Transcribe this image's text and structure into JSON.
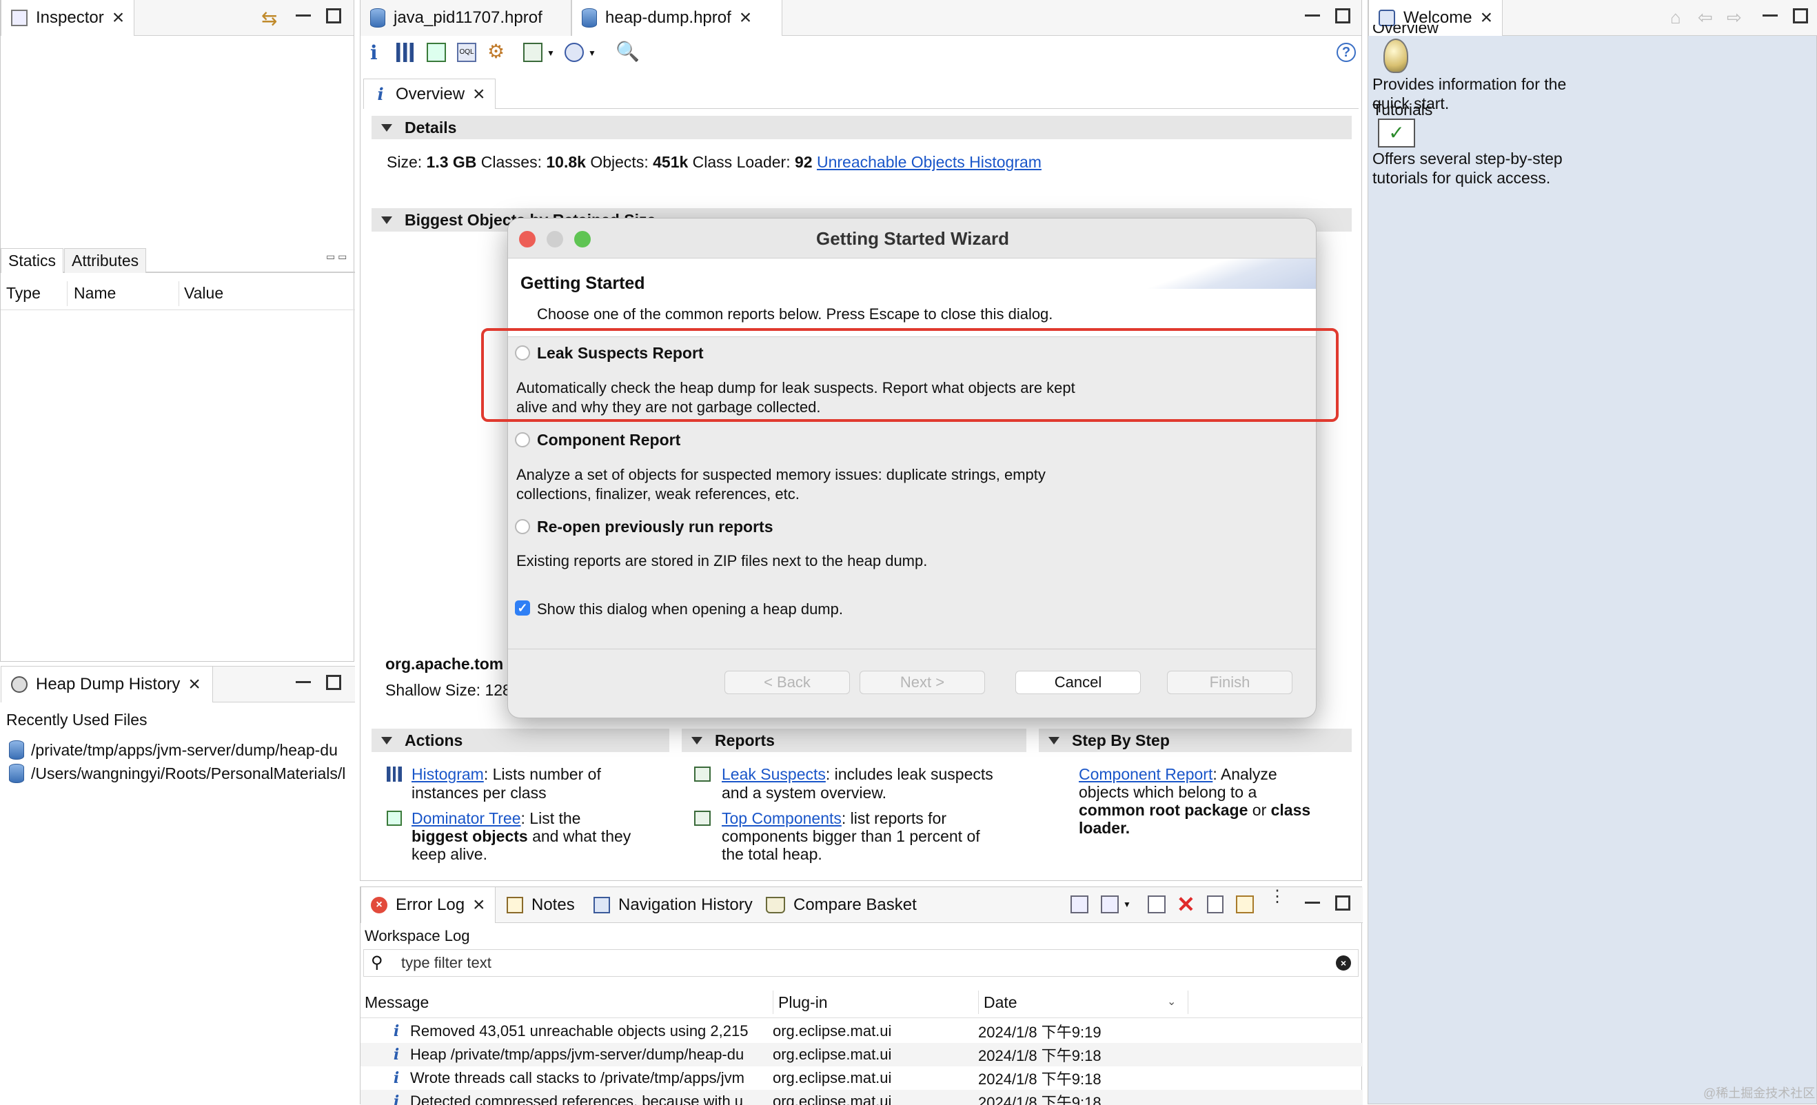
{
  "inspector": {
    "tab": "Inspector",
    "subtabs": [
      "Statics",
      "Attributes"
    ],
    "columns": [
      "Type",
      "Name",
      "Value"
    ]
  },
  "history": {
    "tab": "Heap Dump History",
    "recent_label": "Recently Used Files",
    "files": [
      "/private/tmp/apps/jvm-server/dump/heap-du",
      "/Users/wangningyi/Roots/PersonalMaterials/l"
    ]
  },
  "editor": {
    "tabs": [
      "java_pid11707.hprof",
      "heap-dump.hprof"
    ],
    "overview_tab": "Overview",
    "details": {
      "title": "Details",
      "size_label": "Size:",
      "size": "1.3 GB",
      "classes_label": "Classes:",
      "classes": "10.8k",
      "objects_label": "Objects:",
      "objects": "451k",
      "loader_label": "Class Loader:",
      "loader": "92",
      "link": "Unreachable Objects Histogram"
    },
    "biggest": {
      "title": "Biggest Objects by Retained Size",
      "class": "org.apache.tom",
      "shallow": "Shallow Size: 128"
    },
    "actions": {
      "title": "Actions",
      "items": [
        {
          "link": "Histogram",
          "text": ": Lists number of",
          "text2": "instances per class"
        },
        {
          "link": "Dominator Tree",
          "text": ": List the",
          "bold": "biggest objects",
          "text2": "and what they",
          "text3": "keep alive."
        }
      ]
    },
    "reports": {
      "title": "Reports",
      "items": [
        {
          "link": "Leak Suspects",
          "text": ": includes leak suspects",
          "text2": "and a system overview."
        },
        {
          "link": "Top Components",
          "text": ": list reports for",
          "text2": "components bigger than 1 percent of",
          "text3": "the total heap."
        }
      ]
    },
    "step": {
      "title": "Step By Step",
      "link": "Component Report",
      "text": ": Analyze",
      "text2": "objects which belong to a",
      "bold1": "common root package",
      "or": "or",
      "bold2": "class",
      "bold3": "loader"
    }
  },
  "wizard": {
    "title": "Getting Started Wizard",
    "heading": "Getting Started",
    "subtitle": "Choose one of the common reports below. Press Escape to close this dialog.",
    "options": [
      {
        "label": "Leak Suspects Report",
        "desc1": "Automatically check the heap dump for leak suspects. Report what objects are kept",
        "desc2": "alive and why they are not garbage collected."
      },
      {
        "label": "Component Report",
        "desc1": "Analyze a set of objects for suspected memory issues: duplicate strings, empty",
        "desc2": "collections, finalizer, weak references, etc."
      },
      {
        "label": "Re-open previously run reports",
        "desc1": "Existing reports are stored in ZIP files next to the heap dump.",
        "desc2": ""
      }
    ],
    "checkbox": "Show this dialog when opening a heap dump.",
    "buttons": {
      "back": "< Back",
      "next": "Next >",
      "cancel": "Cancel",
      "finish": "Finish"
    },
    "highlight_color": "#e03a2f"
  },
  "welcome": {
    "tab": "Welcome",
    "overview_title": "Overview",
    "overview_desc1": "Provides information for the",
    "overview_desc2": "quick start.",
    "tutorials_title": "Tutorials",
    "tutorials_desc1": "Offers several step-by-step",
    "tutorials_desc2": "tutorials for quick access."
  },
  "log": {
    "tabs": [
      "Error Log",
      "Notes",
      "Navigation History",
      "Compare Basket"
    ],
    "workspace": "Workspace Log",
    "filter_placeholder": "type filter text",
    "columns": [
      "Message",
      "Plug-in",
      "Date"
    ],
    "rows": [
      {
        "msg": "Removed 43,051 unreachable objects using 2,215",
        "plugin": "org.eclipse.mat.ui",
        "date": "2024/1/8 下午9:19"
      },
      {
        "msg": "Heap /private/tmp/apps/jvm-server/dump/heap-du",
        "plugin": "org.eclipse.mat.ui",
        "date": "2024/1/8 下午9:18"
      },
      {
        "msg": "Wrote threads call stacks to /private/tmp/apps/jvm",
        "plugin": "org.eclipse.mat.ui",
        "date": "2024/1/8 下午9:18"
      },
      {
        "msg": "Detected compressed references, because with u",
        "plugin": "org.eclipse.mat.ui",
        "date": "2024/1/8 下午9:18"
      }
    ]
  },
  "watermark": "@稀土掘金技术社区"
}
